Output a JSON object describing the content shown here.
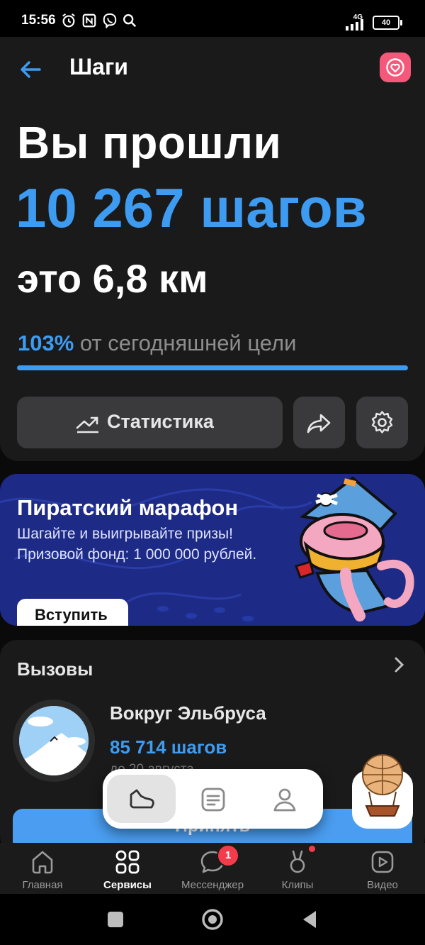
{
  "status_bar": {
    "time": "15:56",
    "network": "4G",
    "battery": "40"
  },
  "header": {
    "title": "Шаги"
  },
  "summary": {
    "line1": "Вы прошли",
    "steps": "10 267 шагов",
    "distance": "это 6,8 км",
    "goal_percent": "103%",
    "goal_text": " от сегодняшней цели",
    "progress": 1.0
  },
  "actions": {
    "statistics_label": "Статистика"
  },
  "banner": {
    "title": "Пиратский марафон",
    "subtitle": "Шагайте и выигрывайте призы! Призовой фонд: 1 000 000 рублей.",
    "join_label": "Вступить"
  },
  "challenges": {
    "title": "Вызовы",
    "item": {
      "name": "Вокруг Эльбруса",
      "steps": "85 714 шагов",
      "date": "до 20 августа"
    },
    "accept_label": "Принять"
  },
  "bottom_nav": {
    "items": [
      {
        "label": "Главная",
        "icon": "home-icon"
      },
      {
        "label": "Сервисы",
        "icon": "services-icon"
      },
      {
        "label": "Мессенджер",
        "icon": "messenger-icon"
      },
      {
        "label": "Клипы",
        "icon": "clips-icon"
      },
      {
        "label": "Видео",
        "icon": "video-icon"
      }
    ],
    "messenger_badge": "1"
  },
  "colors": {
    "accent": "#3d9cf2",
    "banner": "#1d2a86",
    "fav": "#f6587b"
  }
}
